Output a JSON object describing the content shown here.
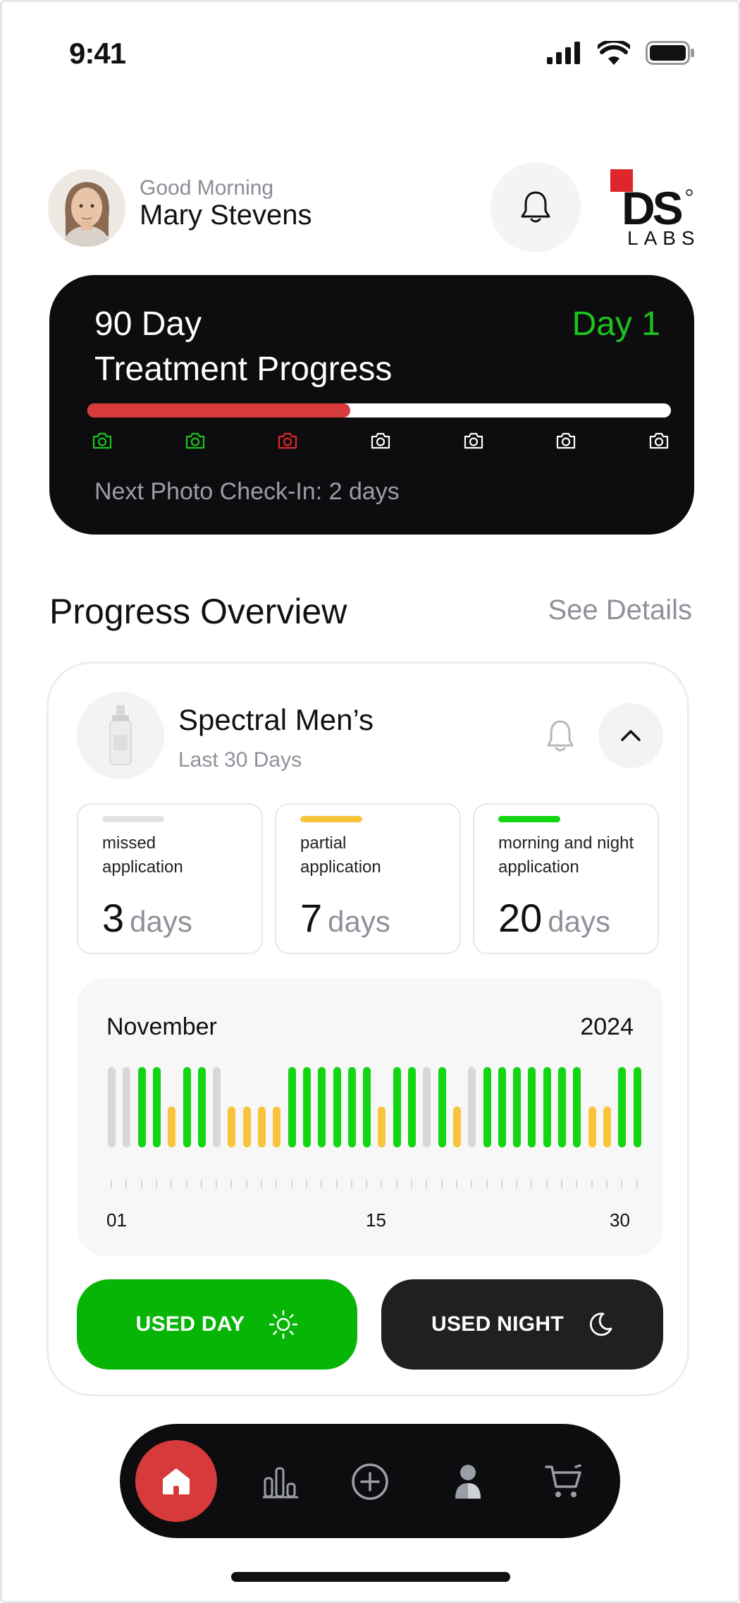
{
  "status_bar": {
    "time": "9:41"
  },
  "header": {
    "greeting": "Good Morning",
    "user_name": "Mary Stevens",
    "logo_text": "DS",
    "logo_sub": "LABS"
  },
  "treatment": {
    "title_line1": "90 Day",
    "title_line2": "Treatment Progress",
    "day_label": "Day 1",
    "progress_fraction": 0.45,
    "checkpoints": [
      "done",
      "done",
      "current",
      "upcoming",
      "upcoming",
      "upcoming",
      "upcoming"
    ],
    "next_photo": "Next Photo Check-In: 2 days"
  },
  "overview": {
    "title": "Progress Overview",
    "see_details": "See Details",
    "product_name": "Spectral Men’s",
    "period": "Last 30 Days",
    "stats": [
      {
        "label": "missed application",
        "value": "3",
        "unit": "days",
        "color": "#e2e2e2"
      },
      {
        "label": "partial application",
        "value": "7",
        "unit": "days",
        "color": "#f7c43a"
      },
      {
        "label": "morning and night application",
        "value": "20",
        "unit": "days",
        "color": "#12d612"
      }
    ],
    "buttons": {
      "used_day": "USED DAY",
      "used_night": "USED NIGHT"
    }
  },
  "chart_data": {
    "type": "bar",
    "month": "November",
    "year": "2024",
    "x_tick_labels": [
      "01",
      "15",
      "30"
    ],
    "legend": {
      "missed": "#d8d8d8",
      "partial": "#f7c43a",
      "full": "#12d612"
    },
    "days": [
      {
        "day": 1,
        "status": "missed"
      },
      {
        "day": 2,
        "status": "missed"
      },
      {
        "day": 3,
        "status": "full"
      },
      {
        "day": 4,
        "status": "full"
      },
      {
        "day": 5,
        "status": "partial"
      },
      {
        "day": 6,
        "status": "full"
      },
      {
        "day": 7,
        "status": "full"
      },
      {
        "day": 8,
        "status": "missed"
      },
      {
        "day": 9,
        "status": "partial"
      },
      {
        "day": 10,
        "status": "partial"
      },
      {
        "day": 11,
        "status": "partial"
      },
      {
        "day": 12,
        "status": "partial"
      },
      {
        "day": 13,
        "status": "full"
      },
      {
        "day": 14,
        "status": "full"
      },
      {
        "day": 15,
        "status": "full"
      },
      {
        "day": 16,
        "status": "full"
      },
      {
        "day": 17,
        "status": "full"
      },
      {
        "day": 18,
        "status": "full"
      },
      {
        "day": 19,
        "status": "partial"
      },
      {
        "day": 20,
        "status": "full"
      },
      {
        "day": 21,
        "status": "full"
      },
      {
        "day": 22,
        "status": "missed"
      },
      {
        "day": 23,
        "status": "full"
      },
      {
        "day": 24,
        "status": "partial"
      },
      {
        "day": 25,
        "status": "missed"
      },
      {
        "day": 26,
        "status": "full"
      },
      {
        "day": 27,
        "status": "full"
      },
      {
        "day": 28,
        "status": "full"
      },
      {
        "day": 29,
        "status": "full"
      },
      {
        "day": 30,
        "status": "full"
      },
      {
        "day": 31,
        "status": "full"
      },
      {
        "day": 32,
        "status": "full"
      },
      {
        "day": 33,
        "status": "partial"
      },
      {
        "day": 34,
        "status": "partial"
      },
      {
        "day": 35,
        "status": "full"
      },
      {
        "day": 36,
        "status": "full"
      }
    ]
  },
  "nav": {
    "items": [
      "home-icon",
      "stats-icon",
      "add-icon",
      "profile-icon",
      "cart-icon"
    ],
    "active": "home-icon"
  },
  "colors": {
    "accent_red": "#d63a3a",
    "accent_green": "#07b507",
    "dark": "#0d0d0f"
  }
}
